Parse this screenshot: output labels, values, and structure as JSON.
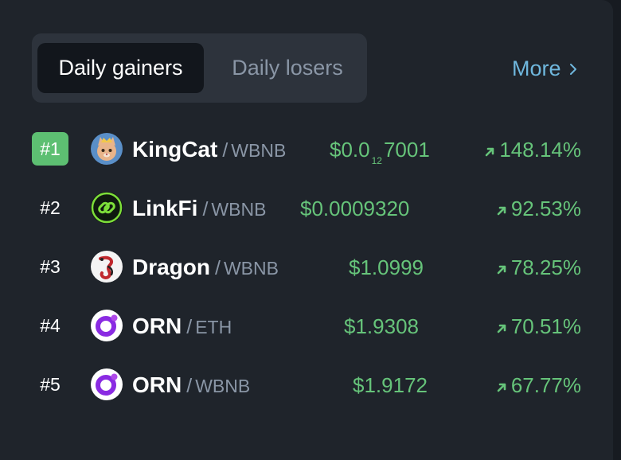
{
  "tabs": {
    "active_label": "Daily gainers",
    "inactive_label": "Daily losers"
  },
  "more_label": "More",
  "colors": {
    "accent_green": "#66c47a",
    "rank_badge": "#5dbf72",
    "link_blue": "#6fb7dd",
    "muted": "#8a96a6"
  },
  "rows": [
    {
      "rank": "#1",
      "icon": "kingcat-icon",
      "symbol": "KingCat",
      "quote": "WBNB",
      "price_main": "$0.0",
      "price_zeros": "12",
      "price_tail": "7001",
      "change": "148.14%"
    },
    {
      "rank": "#2",
      "icon": "linkfi-icon",
      "symbol": "LinkFi",
      "quote": "WBNB",
      "price_main": "$0.0009320",
      "change": "92.53%"
    },
    {
      "rank": "#3",
      "icon": "dragon-icon",
      "symbol": "Dragon",
      "quote": "WBNB",
      "price_main": "$1.0999",
      "change": "78.25%"
    },
    {
      "rank": "#4",
      "icon": "orn-icon",
      "symbol": "ORN",
      "quote": "ETH",
      "price_main": "$1.9308",
      "change": "70.51%"
    },
    {
      "rank": "#5",
      "icon": "orn-icon",
      "symbol": "ORN",
      "quote": "WBNB",
      "price_main": "$1.9172",
      "change": "67.77%"
    }
  ]
}
